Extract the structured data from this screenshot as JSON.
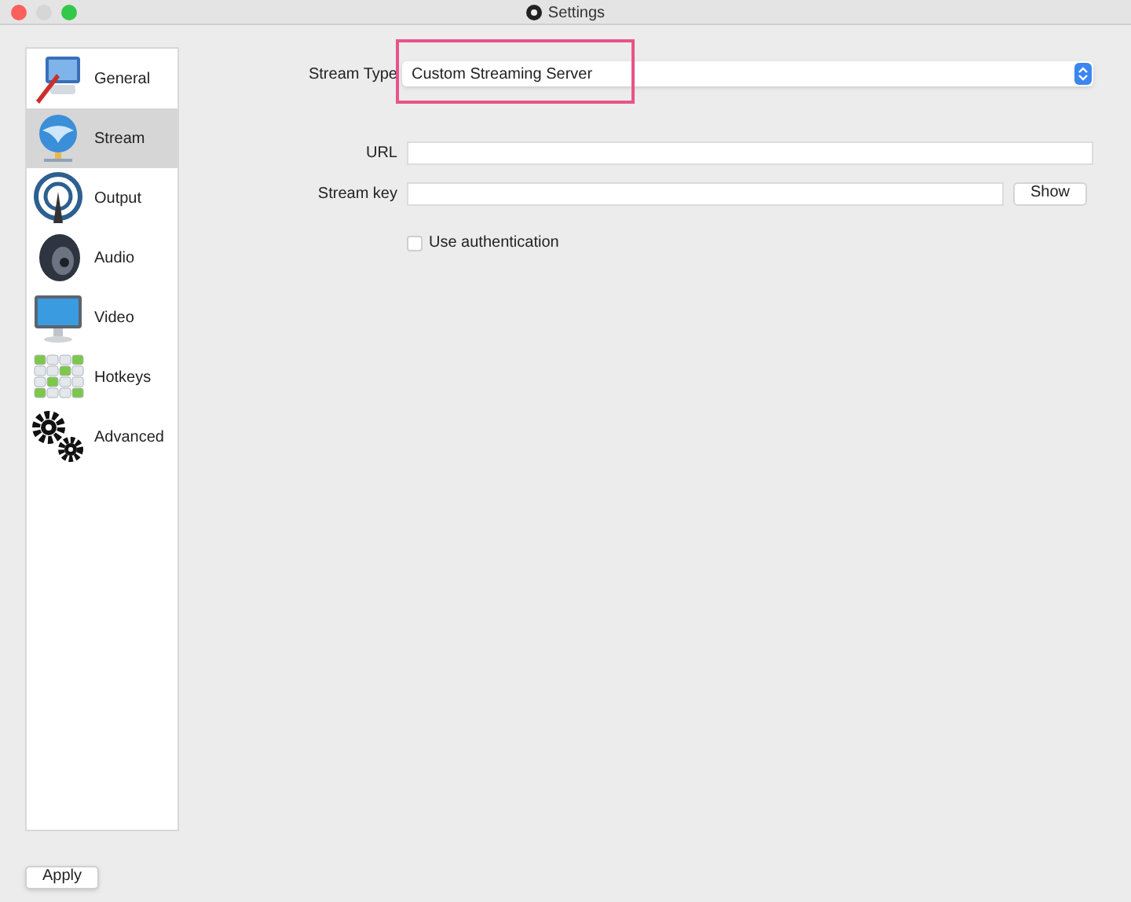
{
  "window": {
    "title": "Settings"
  },
  "sidebar": {
    "items": [
      {
        "label": "General",
        "kind": "general",
        "selected": false
      },
      {
        "label": "Stream",
        "kind": "stream",
        "selected": true
      },
      {
        "label": "Output",
        "kind": "output",
        "selected": false
      },
      {
        "label": "Audio",
        "kind": "audio",
        "selected": false
      },
      {
        "label": "Video",
        "kind": "video",
        "selected": false
      },
      {
        "label": "Hotkeys",
        "kind": "hotkeys",
        "selected": false
      },
      {
        "label": "Advanced",
        "kind": "advanced",
        "selected": false
      }
    ]
  },
  "form": {
    "stream_type": {
      "label": "Stream Type",
      "value": "Custom Streaming Server",
      "highlighted": true
    },
    "url": {
      "label": "URL"
    },
    "stream_key": {
      "label": "Stream key",
      "button": "Show"
    },
    "authentication": {
      "label": "Use authentication",
      "checked": false
    }
  },
  "buttons": [
    "Apply"
  ]
}
